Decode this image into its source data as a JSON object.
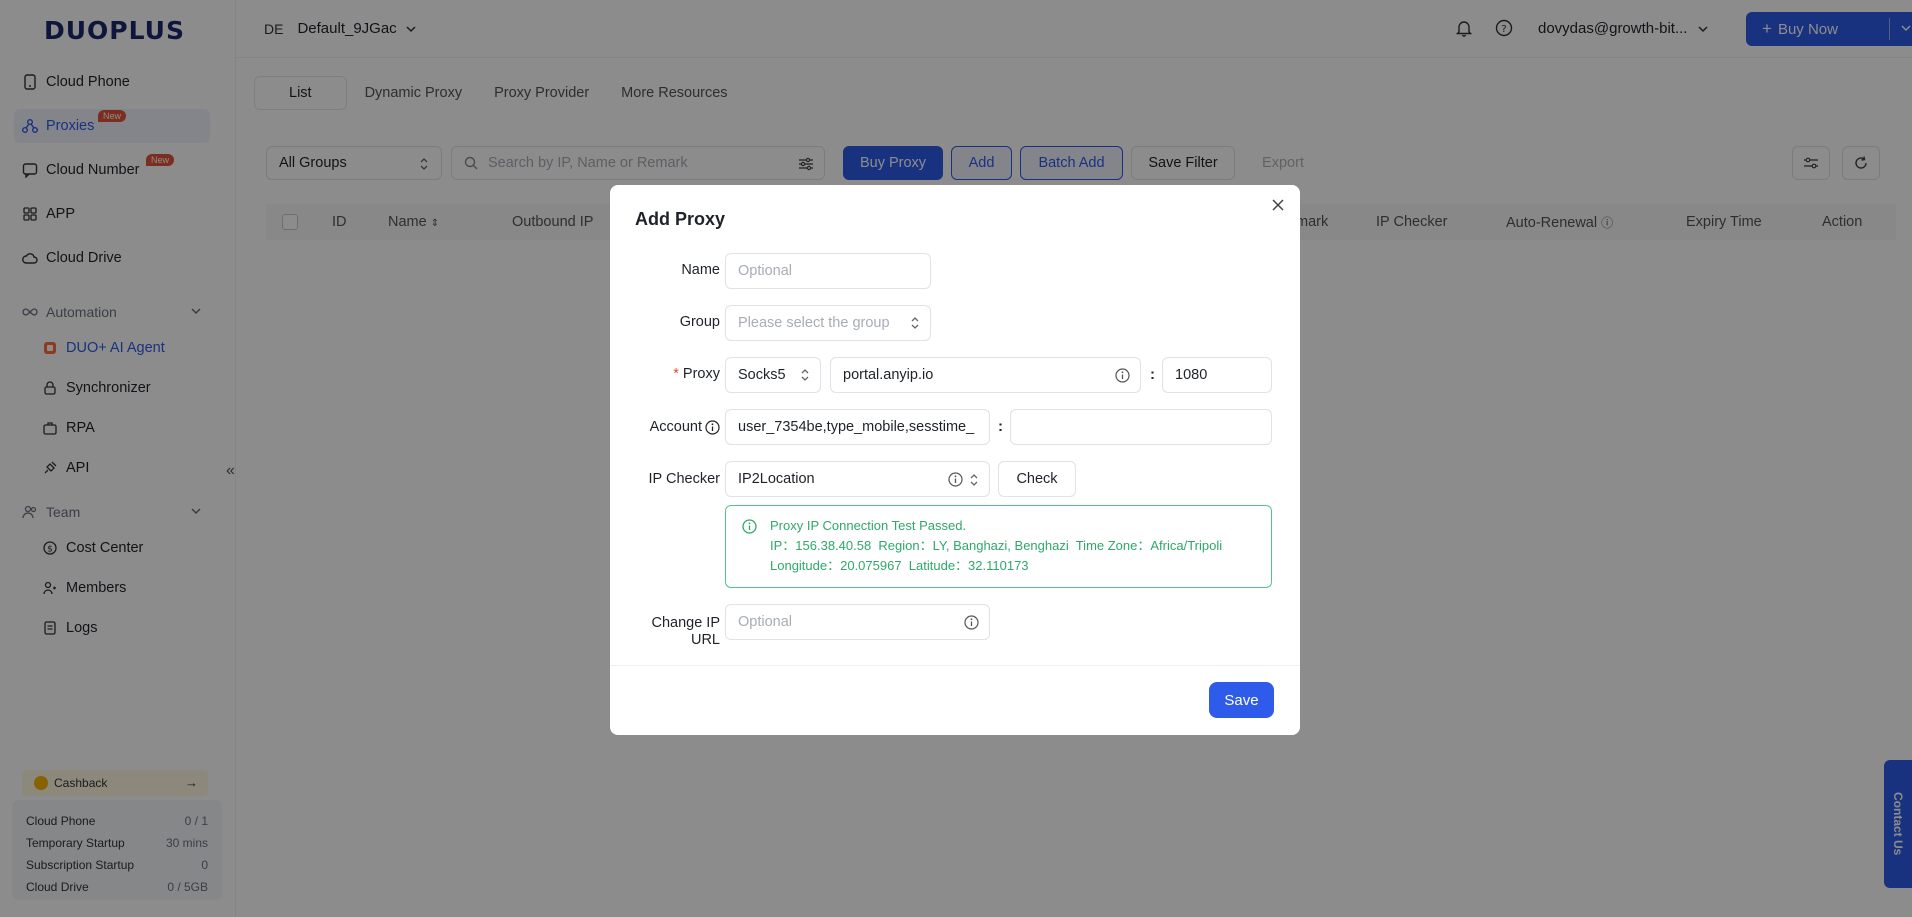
{
  "brand": {
    "logo": "DUOPLUS"
  },
  "sidebar": {
    "items": [
      {
        "label": "Cloud Phone"
      },
      {
        "label": "Proxies",
        "badge": "New"
      },
      {
        "label": "Cloud Number",
        "badge": "New"
      },
      {
        "label": "APP"
      },
      {
        "label": "Cloud Drive"
      }
    ],
    "automation": {
      "label": "Automation",
      "items": [
        {
          "label": "DUO+ AI Agent"
        },
        {
          "label": "Synchronizer"
        },
        {
          "label": "RPA"
        },
        {
          "label": "API"
        }
      ]
    },
    "team": {
      "label": "Team",
      "items": [
        {
          "label": "Cost Center"
        },
        {
          "label": "Members"
        },
        {
          "label": "Logs"
        }
      ]
    },
    "cashback": "Cashback",
    "usage": [
      {
        "label": "Cloud Phone",
        "value": "0 / 1"
      },
      {
        "label": "Temporary Startup",
        "value": "30 mins"
      },
      {
        "label": "Subscription Startup",
        "value": "0"
      },
      {
        "label": "Cloud Drive",
        "value": "0 / 5GB"
      }
    ]
  },
  "header": {
    "env_code": "DE",
    "env_name": "Default_9JGac",
    "user": "dovydas@growth-bit...",
    "buy_now": "Buy Now"
  },
  "tabs": [
    "List",
    "Dynamic Proxy",
    "Proxy Provider",
    "More Resources"
  ],
  "toolbar": {
    "group_select": "All Groups",
    "search_placeholder": "Search by IP, Name or Remark",
    "buy_proxy": "Buy Proxy",
    "add": "Add",
    "batch_add": "Batch Add",
    "save_filter": "Save Filter",
    "export": "Export"
  },
  "table": {
    "columns": [
      "ID",
      "Name",
      "Outbound IP",
      "mark",
      "IP Checker",
      "Auto-Renewal",
      "Expiry Time",
      "Action"
    ]
  },
  "contact_us": "Contact Us",
  "modal": {
    "title": "Add Proxy",
    "name_label": "Name",
    "name_placeholder": "Optional",
    "group_label": "Group",
    "group_placeholder": "Please select the group",
    "proxy_label": "Proxy",
    "proxy_type": "Socks5",
    "proxy_host": "portal.anyip.io",
    "proxy_port": "1080",
    "account_label": "Account",
    "account_user": "user_7354be,type_mobile,sesstime_",
    "account_pass": "",
    "ip_checker_label": "IP Checker",
    "ip_checker_value": "IP2Location",
    "check_button": "Check",
    "result": {
      "title": "Proxy IP Connection Test Passed.",
      "line1": "IP：156.38.40.58  Region：LY, Banghazi, Benghazi  Time Zone：Africa/Tripoli",
      "line2": "Longitude：20.075967  Latitude：32.110173"
    },
    "change_ip_label_1": "Change IP",
    "change_ip_label_2": "URL",
    "change_ip_placeholder": "Optional",
    "save": "Save"
  }
}
